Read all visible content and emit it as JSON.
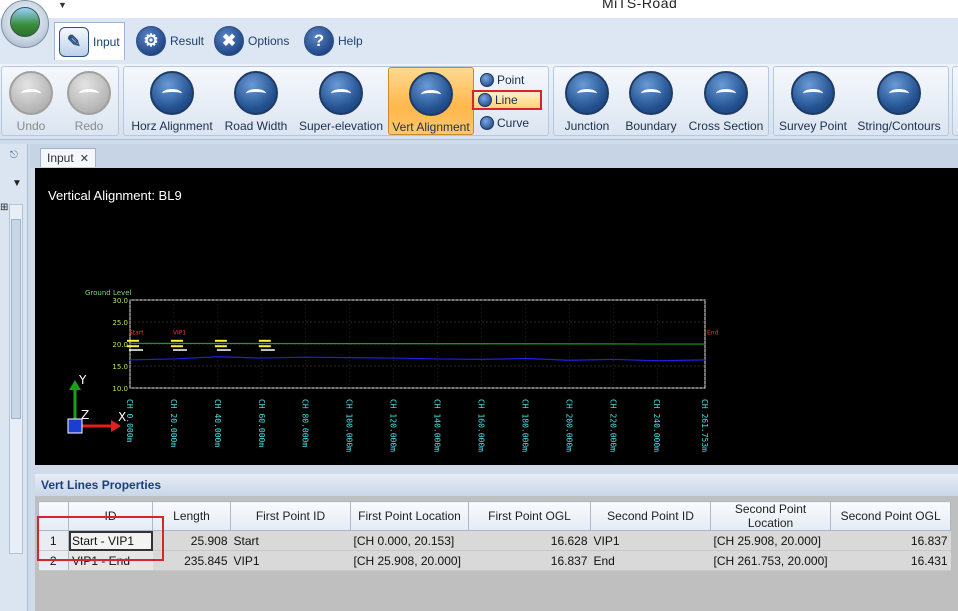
{
  "app": {
    "title": "MiTS-Road"
  },
  "tabs": [
    {
      "label": "Input",
      "icon": "input-icon",
      "active": true
    },
    {
      "label": "Result",
      "icon": "gear-icon"
    },
    {
      "label": "Options",
      "icon": "tools-icon"
    },
    {
      "label": "Help",
      "icon": "help-icon"
    }
  ],
  "ribbon": {
    "undo": "Undo",
    "redo": "Redo",
    "horz_alignment": "Horz Alignment",
    "road_width": "Road Width",
    "super_elevation": "Super-elevation",
    "vert_alignment": "Vert Alignment",
    "point": "Point",
    "line": "Line",
    "curve": "Curve",
    "junction": "Junction",
    "boundary": "Boundary",
    "cross_section": "Cross Section",
    "survey_point": "Survey Point",
    "string_contours": "String/Contours"
  },
  "doc_tab": {
    "label": "Input",
    "close": "✕"
  },
  "canvas": {
    "title": "Vertical Alignment: BL9",
    "axis_y": "Y",
    "axis_z": "Z",
    "axis_x": "X"
  },
  "chart_data": {
    "type": "line",
    "title": "Ground Level",
    "ylim": [
      10.0,
      30.0
    ],
    "yticks": [
      "30.0",
      "25.0",
      "20.0",
      "15.0",
      "10.0"
    ],
    "x_labels": [
      "CH 0.000m",
      "CH 20.000m",
      "CH 40.000m",
      "CH 60.000m",
      "CH 80.000m",
      "CH 100.000m",
      "CH 120.000m",
      "CH 140.000m",
      "CH 160.000m",
      "CH 180.000m",
      "CH 200.000m",
      "CH 220.000m",
      "CH 240.000m",
      "CH 261.753m"
    ],
    "point_labels": [
      "Start",
      "VIP1",
      "End"
    ],
    "series": [
      {
        "x": [
          0,
          20,
          40,
          60,
          80,
          100,
          120,
          140,
          160,
          180,
          200,
          220,
          240,
          261.753
        ],
        "values": [
          16.4,
          16.6,
          17.1,
          16.8,
          17.0,
          16.9,
          16.8,
          16.6,
          16.5,
          16.7,
          16.3,
          16.5,
          16.2,
          16.4
        ],
        "color": "#2020e0"
      },
      {
        "x": [
          0,
          261.753
        ],
        "values": [
          20.153,
          20.0
        ],
        "color": "#1aa01a"
      }
    ]
  },
  "properties": {
    "title": "Vert Lines Properties",
    "columns": [
      "ID",
      "Length",
      "First Point ID",
      "First Point Location",
      "First Point OGL",
      "Second Point ID",
      "Second Point Location",
      "Second Point OGL"
    ],
    "rows": [
      {
        "num": "1",
        "id": "Start - VIP1",
        "length": "25.908",
        "fp_id": "Start",
        "fp_loc": "[CH 0.000, 20.153]",
        "fp_ogl": "16.628",
        "sp_id": "VIP1",
        "sp_loc": "[CH 25.908, 20.000]",
        "sp_ogl": "16.837"
      },
      {
        "num": "2",
        "id": "VIP1 - End",
        "length": "235.845",
        "fp_id": "VIP1",
        "fp_loc": "[CH 25.908, 20.000]",
        "fp_ogl": "16.837",
        "sp_id": "End",
        "sp_loc": "[CH 261.753, 20.000]",
        "sp_ogl": "16.431"
      }
    ]
  },
  "colors": {
    "highlight_red": "#d6262b",
    "active_orange": "#ffb74b",
    "ribbon_blue": "#22508f"
  }
}
